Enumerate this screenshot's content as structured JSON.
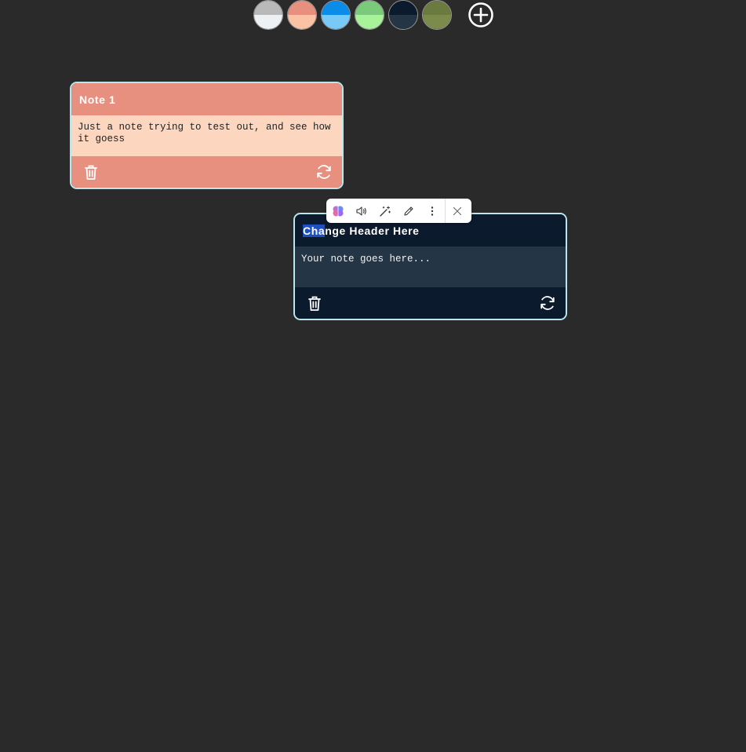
{
  "palette": {
    "swatches": [
      {
        "name": "gray",
        "top": "#b9b9b9",
        "bottom": "#eef1f3"
      },
      {
        "name": "salmon",
        "top": "#e8907f",
        "bottom": "#fcc2a5"
      },
      {
        "name": "blue",
        "top": "#0c8ce9",
        "bottom": "#79c9f8"
      },
      {
        "name": "green",
        "top": "#7bc97b",
        "bottom": "#a8f29a"
      },
      {
        "name": "navy",
        "top": "#0b1a2c",
        "bottom": "#243646"
      },
      {
        "name": "olive",
        "top": "#6b7a3e",
        "bottom": "#7c8a4b"
      }
    ],
    "add_icon": "plus-circle-icon"
  },
  "notes": [
    {
      "header": "Note 1",
      "body": "Just a note trying to test out, and see how it goess",
      "header_color": "#e8907f",
      "body_color": "#fcd6bf"
    },
    {
      "header_selected": "Cha",
      "header_rest": "nge Header Here",
      "body": "Your note goes here...",
      "header_color": "#0b1a2c",
      "body_color": "#243646"
    }
  ],
  "toolbar": {
    "items": [
      "brain-icon",
      "speaker-icon",
      "magic-wand-icon",
      "pencil-icon",
      "more-vertical-icon",
      "close-icon"
    ]
  }
}
